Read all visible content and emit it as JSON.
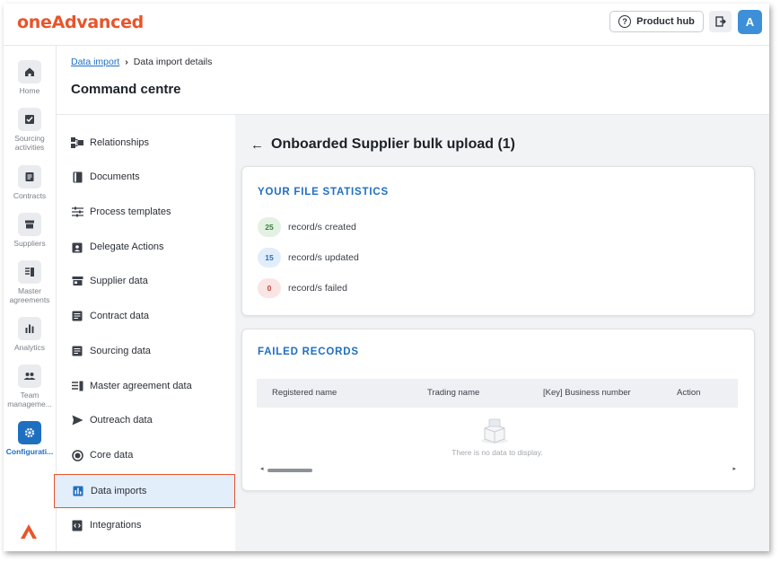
{
  "brand": {
    "logo_text": "oneAdvanced",
    "accent": "#e8542b",
    "primary": "#1f6fc1"
  },
  "topbar": {
    "product_hub_label": "Product hub",
    "avatar_initial": "A"
  },
  "rail": [
    {
      "label": "Home",
      "icon": "home-icon"
    },
    {
      "label": "Sourcing activities",
      "icon": "sourcing-icon"
    },
    {
      "label": "Contracts",
      "icon": "contracts-icon"
    },
    {
      "label": "Suppliers",
      "icon": "store-icon"
    },
    {
      "label": "Master agreements",
      "icon": "master-agreement-icon"
    },
    {
      "label": "Analytics",
      "icon": "chart-icon"
    },
    {
      "label": "Team manageme...",
      "icon": "team-icon"
    },
    {
      "label": "Configurati...",
      "icon": "gear-icon"
    }
  ],
  "breadcrumb": {
    "link": "Data import",
    "current": "Data import details"
  },
  "page_title": "Command centre",
  "nav": [
    {
      "label": "Relationships",
      "icon": "relationships-icon"
    },
    {
      "label": "Documents",
      "icon": "book-icon"
    },
    {
      "label": "Process templates",
      "icon": "sliders-icon"
    },
    {
      "label": "Delegate Actions",
      "icon": "badge-icon"
    },
    {
      "label": "Supplier data",
      "icon": "store-icon"
    },
    {
      "label": "Contract data",
      "icon": "document-icon"
    },
    {
      "label": "Sourcing data",
      "icon": "document-icon"
    },
    {
      "label": "Master agreement data",
      "icon": "master-agreement-icon"
    },
    {
      "label": "Outreach data",
      "icon": "send-icon"
    },
    {
      "label": "Core data",
      "icon": "circle-icon"
    },
    {
      "label": "Data imports",
      "icon": "chart-icon"
    },
    {
      "label": "Integrations",
      "icon": "code-icon"
    }
  ],
  "detail": {
    "title": "Onboarded Supplier bulk upload (1)",
    "stats_heading": "YOUR FILE STATISTICS",
    "stats": [
      {
        "value": "25",
        "label": "record/s created",
        "bg": "#e3f1e3",
        "fg": "#3b7d3e"
      },
      {
        "value": "15",
        "label": "record/s updated",
        "bg": "#e1edfa",
        "fg": "#2d6fb3"
      },
      {
        "value": "0",
        "label": "record/s failed",
        "bg": "#fbe4e4",
        "fg": "#c0413a"
      }
    ],
    "failed_heading": "FAILED RECORDS",
    "columns": [
      "Registered name",
      "Trading name",
      "[Key] Business number",
      "Action"
    ],
    "empty_text": "There is no data to display."
  }
}
